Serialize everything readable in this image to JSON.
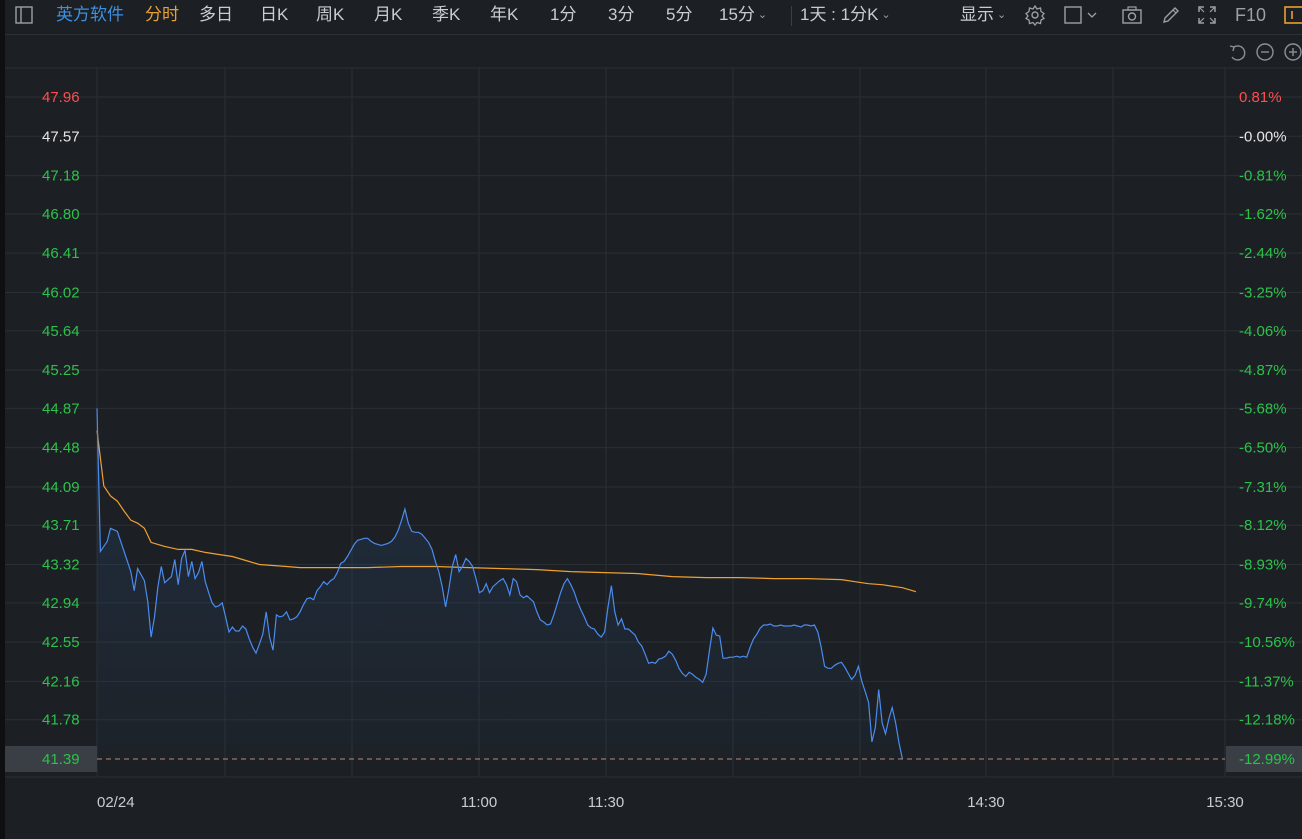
{
  "toolbar": {
    "stock_name": "英方软件",
    "tabs": [
      "分时",
      "多日",
      "日K",
      "周K",
      "月K",
      "季K",
      "年K",
      "1分",
      "3分",
      "5分",
      "15分"
    ],
    "active_tab": "分时",
    "range_label": "1天 : 1分K",
    "display_label": "显示",
    "f10_label": "F10"
  },
  "colors": {
    "price_line": "#4a8cf0",
    "avg_line": "#f0a030",
    "up": "#ff4d4f",
    "down": "#2cc24a",
    "flat": "#e6e6e6",
    "current_price_marker": "#3a3f45"
  },
  "chart_data": {
    "type": "line",
    "date": "02/24",
    "x_ticks": [
      "02/24",
      "11:00",
      "11:30",
      "14:30",
      "15:30"
    ],
    "y_ticks": [
      47.96,
      47.57,
      47.18,
      46.8,
      46.41,
      46.02,
      45.64,
      45.25,
      44.87,
      44.48,
      44.09,
      43.71,
      43.32,
      42.94,
      42.55,
      42.16,
      41.78,
      41.39
    ],
    "pct_ticks": [
      "0.81%",
      "-0.00%",
      "-0.81%",
      "-1.62%",
      "-2.44%",
      "-3.25%",
      "-4.06%",
      "-4.87%",
      "-5.68%",
      "-6.50%",
      "-7.31%",
      "-8.12%",
      "-8.93%",
      "-9.74%",
      "-10.56%",
      "-11.37%",
      "-12.18%",
      "-12.99%"
    ],
    "ylim": [
      41.39,
      47.96
    ],
    "prev_close": 47.57,
    "current_price": 41.39,
    "grid": true,
    "series": [
      {
        "key": "price",
        "values": [
          [
            0,
            44.87
          ],
          [
            1,
            43.45
          ],
          [
            3,
            43.55
          ],
          [
            4,
            43.68
          ],
          [
            6,
            43.65
          ],
          [
            8,
            43.45
          ],
          [
            10,
            43.25
          ],
          [
            11,
            43.06
          ],
          [
            12,
            43.28
          ],
          [
            14,
            43.16
          ],
          [
            15,
            42.95
          ],
          [
            16,
            42.6
          ],
          [
            17,
            42.8
          ],
          [
            18,
            43.1
          ],
          [
            19,
            43.3
          ],
          [
            20,
            43.14
          ],
          [
            22,
            43.2
          ],
          [
            23,
            43.37
          ],
          [
            24,
            43.12
          ],
          [
            25,
            43.38
          ],
          [
            26,
            43.46
          ],
          [
            27,
            43.2
          ],
          [
            28,
            43.35
          ],
          [
            29,
            43.18
          ],
          [
            30,
            43.24
          ],
          [
            31,
            43.35
          ],
          [
            32,
            43.15
          ],
          [
            33,
            43.04
          ],
          [
            34,
            42.94
          ],
          [
            35,
            42.9
          ],
          [
            36,
            42.91
          ],
          [
            37,
            42.94
          ],
          [
            38,
            42.8
          ],
          [
            39,
            42.65
          ],
          [
            40,
            42.7
          ],
          [
            41,
            42.66
          ],
          [
            42,
            42.66
          ],
          [
            43,
            42.71
          ],
          [
            44,
            42.68
          ],
          [
            45,
            42.58
          ],
          [
            46,
            42.5
          ],
          [
            47,
            42.44
          ],
          [
            48,
            42.53
          ],
          [
            49,
            42.63
          ],
          [
            50,
            42.85
          ],
          [
            51,
            42.6
          ],
          [
            52,
            42.47
          ],
          [
            53,
            42.82
          ],
          [
            54,
            42.8
          ],
          [
            55,
            42.81
          ],
          [
            56,
            42.85
          ],
          [
            57,
            42.77
          ],
          [
            58,
            42.78
          ],
          [
            59,
            42.8
          ],
          [
            60,
            42.85
          ],
          [
            61,
            42.92
          ],
          [
            62,
            42.98
          ],
          [
            63,
            42.99
          ],
          [
            64,
            42.97
          ],
          [
            65,
            43.06
          ],
          [
            66,
            43.1
          ],
          [
            67,
            43.15
          ],
          [
            68,
            43.12
          ],
          [
            69,
            43.16
          ],
          [
            70,
            43.18
          ],
          [
            71,
            43.24
          ],
          [
            72,
            43.33
          ],
          [
            73,
            43.35
          ],
          [
            74,
            43.4
          ],
          [
            75,
            43.46
          ],
          [
            76,
            43.52
          ],
          [
            77,
            43.56
          ],
          [
            78,
            43.57
          ],
          [
            79,
            43.58
          ],
          [
            80,
            43.58
          ],
          [
            81,
            43.55
          ],
          [
            82,
            43.53
          ],
          [
            83,
            43.52
          ],
          [
            84,
            43.51
          ],
          [
            85,
            43.52
          ],
          [
            86,
            43.53
          ],
          [
            87,
            43.55
          ],
          [
            88,
            43.59
          ],
          [
            89,
            43.66
          ],
          [
            90,
            43.76
          ],
          [
            91,
            43.87
          ],
          [
            92,
            43.73
          ],
          [
            93,
            43.65
          ],
          [
            94,
            43.64
          ],
          [
            95,
            43.64
          ],
          [
            96,
            43.62
          ],
          [
            97,
            43.58
          ],
          [
            98,
            43.54
          ],
          [
            99,
            43.47
          ],
          [
            100,
            43.35
          ],
          [
            101,
            43.25
          ],
          [
            102,
            43.1
          ],
          [
            103,
            42.9
          ],
          [
            104,
            43.08
          ],
          [
            105,
            43.3
          ],
          [
            106,
            43.42
          ],
          [
            107,
            43.25
          ],
          [
            108,
            43.3
          ],
          [
            109,
            43.38
          ],
          [
            110,
            43.35
          ],
          [
            111,
            43.3
          ],
          [
            112,
            43.18
          ],
          [
            113,
            43.04
          ],
          [
            114,
            43.06
          ],
          [
            115,
            43.13
          ],
          [
            116,
            43.04
          ],
          [
            117,
            43.1
          ],
          [
            118,
            43.13
          ],
          [
            119,
            43.16
          ],
          [
            120,
            43.18
          ],
          [
            121,
            43.12
          ],
          [
            122,
            43.02
          ],
          [
            123,
            43.18
          ],
          [
            124,
            43.15
          ],
          [
            125,
            43.02
          ],
          [
            126,
            42.99
          ],
          [
            127,
            43.01
          ],
          [
            128,
            42.98
          ],
          [
            129,
            42.95
          ],
          [
            130,
            42.85
          ],
          [
            131,
            42.77
          ],
          [
            132,
            42.75
          ],
          [
            133,
            42.72
          ],
          [
            134,
            42.73
          ],
          [
            135,
            42.82
          ],
          [
            136,
            42.93
          ],
          [
            137,
            43.04
          ],
          [
            138,
            43.13
          ],
          [
            139,
            43.18
          ],
          [
            140,
            43.12
          ],
          [
            141,
            43.05
          ],
          [
            142,
            42.95
          ],
          [
            143,
            42.87
          ],
          [
            144,
            42.8
          ],
          [
            145,
            42.72
          ],
          [
            146,
            42.69
          ],
          [
            147,
            42.68
          ],
          [
            148,
            42.63
          ],
          [
            149,
            42.6
          ],
          [
            150,
            42.65
          ],
          [
            151,
            42.9
          ],
          [
            152,
            43.11
          ],
          [
            153,
            42.85
          ],
          [
            154,
            42.72
          ],
          [
            155,
            42.78
          ],
          [
            156,
            42.68
          ],
          [
            157,
            42.68
          ],
          [
            158,
            42.65
          ],
          [
            159,
            42.62
          ],
          [
            160,
            42.55
          ],
          [
            161,
            42.51
          ],
          [
            162,
            42.43
          ],
          [
            163,
            42.34
          ],
          [
            164,
            42.35
          ],
          [
            165,
            42.34
          ],
          [
            166,
            42.38
          ],
          [
            167,
            42.39
          ],
          [
            168,
            42.41
          ],
          [
            169,
            42.46
          ],
          [
            170,
            42.43
          ],
          [
            171,
            42.37
          ],
          [
            172,
            42.29
          ],
          [
            173,
            42.24
          ],
          [
            174,
            42.21
          ],
          [
            175,
            42.25
          ],
          [
            176,
            42.23
          ],
          [
            177,
            42.2
          ],
          [
            178,
            42.18
          ],
          [
            179,
            42.15
          ],
          [
            180,
            42.23
          ],
          [
            181,
            42.47
          ],
          [
            182,
            42.69
          ],
          [
            183,
            42.62
          ],
          [
            184,
            42.61
          ],
          [
            185,
            42.39
          ],
          [
            186,
            42.39
          ],
          [
            187,
            42.4
          ],
          [
            188,
            42.4
          ],
          [
            189,
            42.41
          ],
          [
            190,
            42.4
          ],
          [
            191,
            42.41
          ],
          [
            192,
            42.4
          ],
          [
            193,
            42.5
          ],
          [
            194,
            42.58
          ],
          [
            195,
            42.63
          ],
          [
            196,
            42.69
          ],
          [
            197,
            42.72
          ],
          [
            198,
            42.72
          ],
          [
            199,
            42.73
          ],
          [
            200,
            42.71
          ],
          [
            201,
            42.71
          ],
          [
            202,
            42.72
          ],
          [
            203,
            42.71
          ],
          [
            204,
            42.71
          ],
          [
            205,
            42.71
          ],
          [
            206,
            42.72
          ],
          [
            207,
            42.71
          ],
          [
            208,
            42.7
          ],
          [
            209,
            42.72
          ],
          [
            210,
            42.72
          ],
          [
            211,
            42.71
          ],
          [
            212,
            42.72
          ],
          [
            213,
            42.65
          ],
          [
            214,
            42.5
          ],
          [
            215,
            42.31
          ],
          [
            216,
            42.29
          ],
          [
            217,
            42.29
          ],
          [
            218,
            42.32
          ],
          [
            219,
            42.34
          ],
          [
            220,
            42.35
          ],
          [
            221,
            42.3
          ],
          [
            222,
            42.24
          ],
          [
            223,
            42.18
          ],
          [
            224,
            42.22
          ],
          [
            225,
            42.31
          ],
          [
            226,
            42.16
          ],
          [
            227,
            42.06
          ],
          [
            228,
            41.95
          ],
          [
            229,
            41.56
          ],
          [
            230,
            41.7
          ],
          [
            231,
            42.08
          ],
          [
            232,
            41.75
          ],
          [
            233,
            41.64
          ],
          [
            234,
            41.79
          ],
          [
            235,
            41.9
          ],
          [
            236,
            41.75
          ],
          [
            237,
            41.55
          ],
          [
            238,
            41.39
          ]
        ]
      },
      {
        "key": "avg",
        "values": [
          [
            0,
            44.65
          ],
          [
            2,
            44.1
          ],
          [
            4,
            44.0
          ],
          [
            6,
            43.95
          ],
          [
            8,
            43.85
          ],
          [
            10,
            43.76
          ],
          [
            12,
            43.73
          ],
          [
            14,
            43.68
          ],
          [
            16,
            43.54
          ],
          [
            18,
            43.52
          ],
          [
            20,
            43.5
          ],
          [
            24,
            43.47
          ],
          [
            28,
            43.47
          ],
          [
            32,
            43.44
          ],
          [
            36,
            43.42
          ],
          [
            40,
            43.4
          ],
          [
            44,
            43.36
          ],
          [
            48,
            43.32
          ],
          [
            52,
            43.31
          ],
          [
            56,
            43.3
          ],
          [
            60,
            43.29
          ],
          [
            70,
            43.29
          ],
          [
            80,
            43.29
          ],
          [
            90,
            43.3
          ],
          [
            100,
            43.3
          ],
          [
            110,
            43.29
          ],
          [
            120,
            43.28
          ],
          [
            130,
            43.27
          ],
          [
            140,
            43.25
          ],
          [
            150,
            43.24
          ],
          [
            160,
            43.23
          ],
          [
            170,
            43.2
          ],
          [
            180,
            43.19
          ],
          [
            190,
            43.19
          ],
          [
            200,
            43.18
          ],
          [
            210,
            43.18
          ],
          [
            220,
            43.17
          ],
          [
            224,
            43.15
          ],
          [
            228,
            43.13
          ],
          [
            232,
            43.12
          ],
          [
            236,
            43.1
          ],
          [
            238,
            43.09
          ],
          [
            240,
            43.07
          ],
          [
            242,
            43.05
          ]
        ]
      }
    ]
  }
}
